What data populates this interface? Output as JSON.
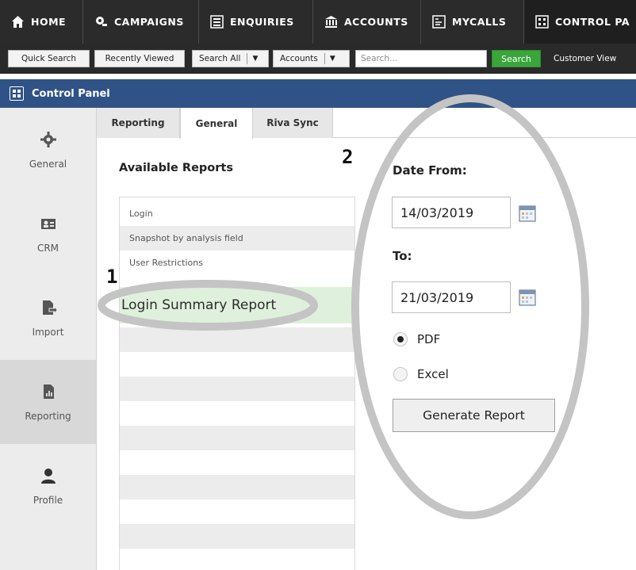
{
  "topnav": {
    "items": [
      {
        "label": "HOME",
        "icon": "home-icon"
      },
      {
        "label": "CAMPAIGNS",
        "icon": "campaigns-icon"
      },
      {
        "label": "ENQUIRIES",
        "icon": "enquiries-icon"
      },
      {
        "label": "ACCOUNTS",
        "icon": "bank-icon"
      },
      {
        "label": "MYCALLS",
        "icon": "calls-icon"
      },
      {
        "label": "CONTROL PA",
        "icon": "control-panel-icon"
      }
    ],
    "active": "CONTROL PA"
  },
  "quickbar": {
    "quick_search": "Quick Search",
    "recently_viewed": "Recently Viewed",
    "search_all": "Search All",
    "accounts": "Accounts",
    "search_placeholder": "Search...",
    "search_button": "Search",
    "customer_view": "Customer View"
  },
  "panel": {
    "title": "Control Panel"
  },
  "sidebar": {
    "items": [
      {
        "label": "General",
        "icon": "gear-icon"
      },
      {
        "label": "CRM",
        "icon": "crm-icon"
      },
      {
        "label": "Import",
        "icon": "import-icon"
      },
      {
        "label": "Reporting",
        "icon": "reporting-icon"
      },
      {
        "label": "Profile",
        "icon": "user-icon"
      }
    ],
    "active": "Reporting"
  },
  "tabs": [
    "Reporting",
    "General",
    "Riva Sync"
  ],
  "active_tab": "General",
  "reports": {
    "title": "Available Reports",
    "items": [
      "Login",
      "Snapshot by analysis field",
      "User Restrictions",
      "Login Summary Report"
    ],
    "selected": "Login Summary Report"
  },
  "form": {
    "date_from_label": "Date From:",
    "date_from": "14/03/2019",
    "to_label": "To:",
    "date_to": "21/03/2019",
    "format_options": [
      "PDF",
      "Excel"
    ],
    "format_selected": "PDF",
    "generate_button": "Generate Report"
  },
  "callouts": [
    "1",
    "2"
  ],
  "colors": {
    "nav_bg": "#2b2b2b",
    "panel_header": "#2f5386",
    "search_button": "#39a53b",
    "selected_row": "#dff1dc",
    "callout_ring": "#c4c4c4"
  }
}
